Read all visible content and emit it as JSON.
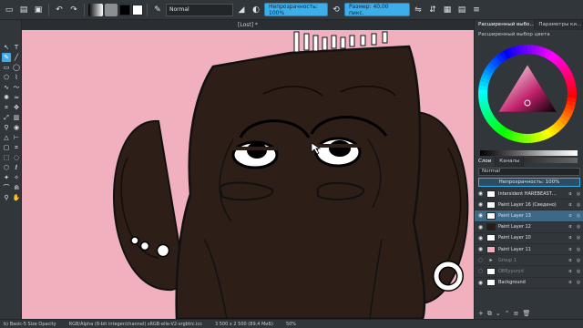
{
  "toolbar": {
    "blend_mode": "Normal",
    "opacity_label": "Непрозрачность: 100%",
    "size_label": "Размер: 40,00 пикс.",
    "fg_color": "#000000",
    "bg_color": "#ffffff",
    "buttons": [
      "new-document-icon",
      "open-icon",
      "save-icon",
      "undo-icon",
      "redo-icon"
    ]
  },
  "canvas": {
    "tab_title": "[Lost] *",
    "background": "#f1b0bd",
    "character_color": "#2e1e18"
  },
  "dock": {
    "tabs": [
      "Расширенный выбо…",
      "Параметры ки…"
    ],
    "selector_title": "Расширенный выбор цвета",
    "layer_tabs": [
      "Слои",
      "Каналы"
    ],
    "blend_label": "Normal",
    "opacity_label": "Непрозрачность: 100%",
    "layers": [
      {
        "name": "Intersident HAREBEAST…",
        "visible": true,
        "thumb": "white",
        "selected": false,
        "dim": false
      },
      {
        "name": "Paint Layer 16 (Сведено)",
        "visible": true,
        "thumb": "white",
        "selected": false,
        "dim": false
      },
      {
        "name": "Paint Layer 13",
        "visible": true,
        "thumb": "white",
        "selected": true,
        "dim": false
      },
      {
        "name": "Paint Layer 12",
        "visible": true,
        "thumb": "dark",
        "selected": false,
        "dim": false
      },
      {
        "name": "Paint Layer 10",
        "visible": true,
        "thumb": "white",
        "selected": false,
        "dim": false
      },
      {
        "name": "Paint Layer 11",
        "visible": true,
        "thumb": "pink",
        "selected": false,
        "dim": false
      },
      {
        "name": "Group 1",
        "visible": false,
        "thumb": "folder",
        "selected": false,
        "dim": true
      },
      {
        "name": "OBEyyuryd",
        "visible": false,
        "thumb": "white",
        "selected": false,
        "dim": true
      },
      {
        "name": "Background",
        "visible": true,
        "thumb": "white",
        "selected": false,
        "dim": false
      }
    ]
  },
  "status": {
    "brush": "b) Basic-5 Size Opacity",
    "colorspace": "RGB/Alpha (8-bit integer/channel) sRGB-elle-V2-srgbtrc.icc",
    "size": "3 500 x 2 500 (89,4 МиБ)",
    "zoom": "50%"
  }
}
